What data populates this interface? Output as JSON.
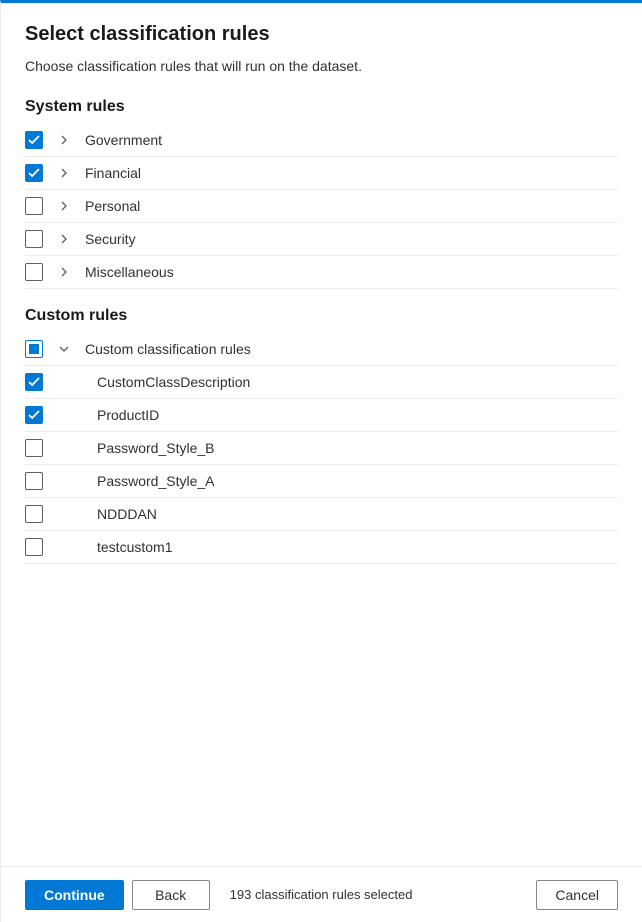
{
  "title": "Select classification rules",
  "subtitle": "Choose classification rules that will run on the dataset.",
  "sections": {
    "system": {
      "heading": "System rules",
      "items": [
        {
          "label": "Government",
          "checked": true,
          "expandable": true,
          "expanded": false
        },
        {
          "label": "Financial",
          "checked": true,
          "expandable": true,
          "expanded": false
        },
        {
          "label": "Personal",
          "checked": false,
          "expandable": true,
          "expanded": false
        },
        {
          "label": "Security",
          "checked": false,
          "expandable": true,
          "expanded": false
        },
        {
          "label": "Miscellaneous",
          "checked": false,
          "expandable": true,
          "expanded": false
        }
      ]
    },
    "custom": {
      "heading": "Custom rules",
      "group": {
        "label": "Custom classification rules",
        "checked": "indeterminate",
        "expanded": true
      },
      "items": [
        {
          "label": "CustomClassDescription",
          "checked": true
        },
        {
          "label": "ProductID",
          "checked": true
        },
        {
          "label": "Password_Style_B",
          "checked": false
        },
        {
          "label": "Password_Style_A",
          "checked": false
        },
        {
          "label": "NDDDAN",
          "checked": false
        },
        {
          "label": "testcustom1",
          "checked": false
        }
      ]
    }
  },
  "footer": {
    "continue_label": "Continue",
    "back_label": "Back",
    "cancel_label": "Cancel",
    "status": "193 classification rules selected"
  }
}
